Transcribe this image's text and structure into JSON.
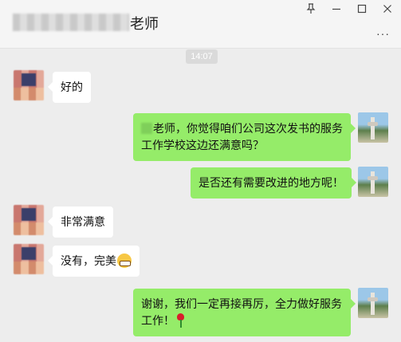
{
  "header": {
    "title": "老师"
  },
  "timestamp": "14:07",
  "messages": [
    {
      "side": "left",
      "text": "好的"
    },
    {
      "side": "right",
      "text": "老师，你觉得咱们公司这次发书的服务工作学校这边还满意吗？"
    },
    {
      "side": "right",
      "text": "是否还有需要改进的地方呢！"
    },
    {
      "side": "left",
      "text": "非常满意"
    },
    {
      "side": "left",
      "text": "没有，完美",
      "emoji": "grinning-face"
    },
    {
      "side": "right",
      "text": "谢谢，我们一定再接再厉，全力做好服务工作！",
      "emoji": "rose"
    }
  ],
  "colors": {
    "outgoing_bubble": "#95ec69",
    "incoming_bubble": "#ffffff",
    "background": "#ededed"
  },
  "window_controls": [
    "pin-icon",
    "minimize-icon",
    "maximize-icon",
    "close-icon"
  ]
}
